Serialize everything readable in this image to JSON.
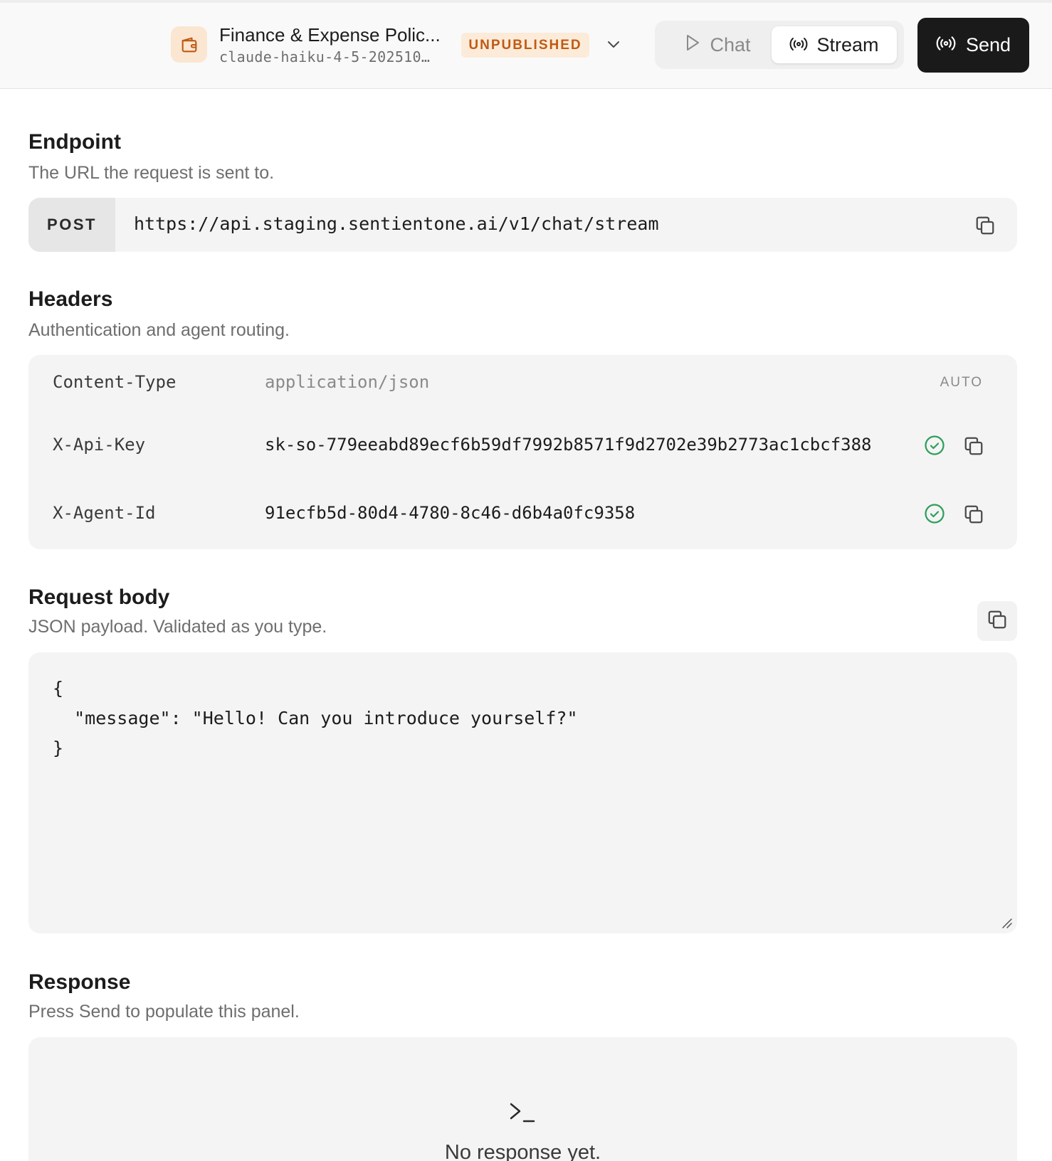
{
  "header": {
    "agent_name": "Finance & Expense Polic...",
    "agent_model": "claude-haiku-4-5-202510…",
    "status_badge": "UNPUBLISHED",
    "mode_tabs": [
      {
        "label": "Chat",
        "active": false
      },
      {
        "label": "Stream",
        "active": true
      }
    ],
    "send_label": "Send"
  },
  "endpoint": {
    "title": "Endpoint",
    "subtitle": "The URL the request is sent to.",
    "method": "POST",
    "url": "https://api.staging.sentientone.ai/v1/chat/stream"
  },
  "headers": {
    "title": "Headers",
    "subtitle": "Authentication and agent routing.",
    "rows": [
      {
        "key": "Content-Type",
        "value": "application/json",
        "tag": "AUTO"
      },
      {
        "key": "X-Api-Key",
        "value": "sk-so-779eeabd89ecf6b59df7992b8571f9d2702e39b2773ac1cbcf388",
        "valid": true
      },
      {
        "key": "X-Agent-Id",
        "value": "91ecfb5d-80d4-4780-8c46-d6b4a0fc9358",
        "valid": true
      }
    ]
  },
  "request_body": {
    "title": "Request body",
    "subtitle": "JSON payload. Validated as you type.",
    "content": "{\n  \"message\": \"Hello! Can you introduce yourself?\"\n}"
  },
  "response": {
    "title": "Response",
    "subtitle": "Press Send to populate this panel.",
    "empty_text": "No response yet."
  },
  "colors": {
    "accent_orange": "#c05a12",
    "badge_bg": "#fcebd9",
    "send_bg": "#1a1a1a",
    "valid_green": "#2e9e5b"
  },
  "icons": {
    "agent": "wallet-icon",
    "chat": "play-icon",
    "stream": "broadcast-icon",
    "send": "broadcast-icon",
    "copy": "copy-icon",
    "valid": "check-circle-icon",
    "terminal": "terminal-prompt-icon"
  }
}
